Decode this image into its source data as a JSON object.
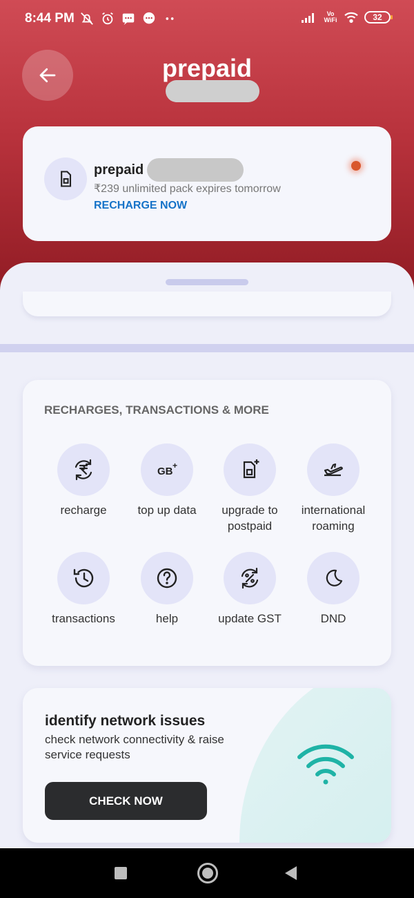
{
  "status_bar": {
    "time": "8:44 PM",
    "network": "Vo WiFi",
    "battery": "32"
  },
  "header": {
    "title": "prepaid"
  },
  "sim_card": {
    "plan_name": "prepaid",
    "subtitle": "₹239 unlimited pack expires tomorrow",
    "action": "RECHARGE NOW"
  },
  "services": {
    "title": "RECHARGES, TRANSACTIONS & MORE",
    "items": [
      {
        "label": "recharge",
        "icon": "rupee-refresh-icon"
      },
      {
        "label": "top up data",
        "icon": "gb-plus-icon"
      },
      {
        "label": "upgrade to postpaid",
        "icon": "sim-plus-icon"
      },
      {
        "label": "international roaming",
        "icon": "airplane-icon"
      },
      {
        "label": "transactions",
        "icon": "history-icon"
      },
      {
        "label": "help",
        "icon": "question-icon"
      },
      {
        "label": "update GST",
        "icon": "percent-refresh-icon"
      },
      {
        "label": "DND",
        "icon": "moon-icon"
      }
    ]
  },
  "network_card": {
    "title": "identify network issues",
    "description": "check network connectivity & raise service requests",
    "button": "CHECK NOW"
  },
  "colors": {
    "accent_link": "#1673c8",
    "hero": "#b8323c",
    "wifi": "#1fb3a6"
  }
}
